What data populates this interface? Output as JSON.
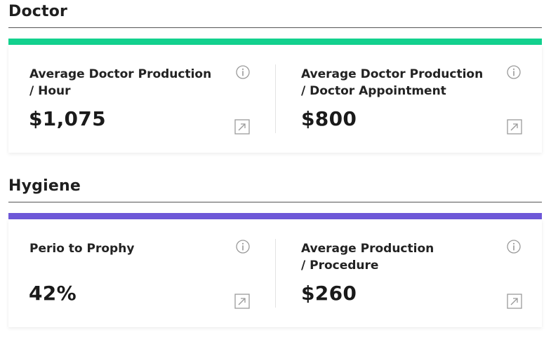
{
  "sections": [
    {
      "title": "Doctor",
      "accent_color": "#12d18e",
      "metrics": [
        {
          "label": "Average Doctor Production / Hour",
          "value": "$1,075",
          "info_icon": "info-circle-icon",
          "expand_icon": "expand-arrow-icon"
        },
        {
          "label": "Average Doctor Production / Doctor Appointment",
          "value": "$800",
          "info_icon": "info-circle-icon",
          "expand_icon": "expand-arrow-icon"
        }
      ]
    },
    {
      "title": "Hygiene",
      "accent_color": "#6e58d8",
      "metrics": [
        {
          "label": "Perio to Prophy",
          "value": "42%",
          "info_icon": "info-circle-icon",
          "expand_icon": "expand-arrow-icon"
        },
        {
          "label": "Average Production / Procedure",
          "value": "$260",
          "info_icon": "info-circle-icon",
          "expand_icon": "expand-arrow-icon"
        }
      ]
    }
  ],
  "colors": {
    "rule": "#555555",
    "icon": "#9a9a9a",
    "text": "#1f1f1f"
  }
}
